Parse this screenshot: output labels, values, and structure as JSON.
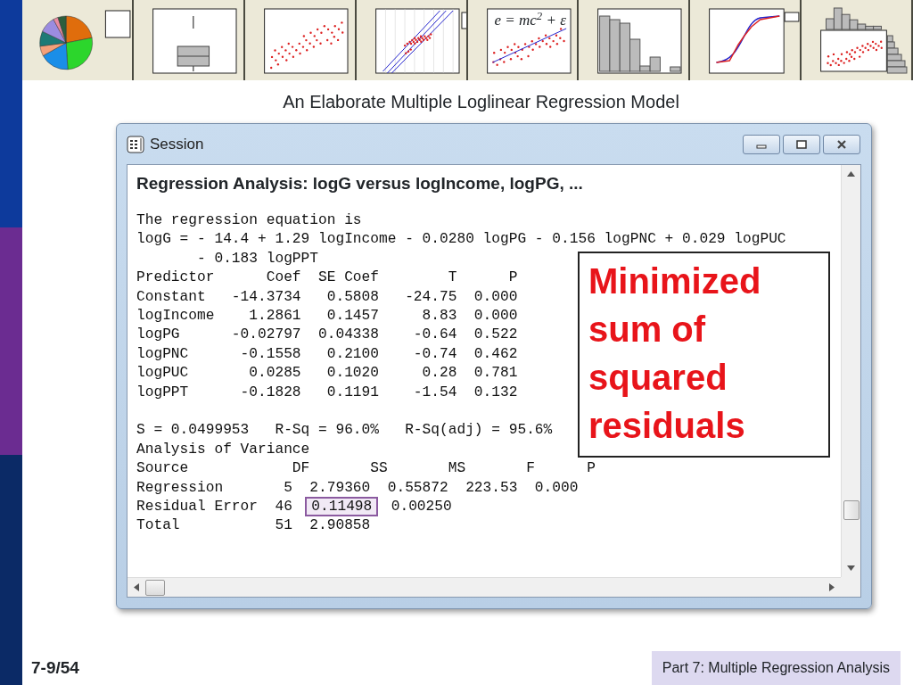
{
  "thumbnails": [
    {
      "kind": "pie"
    },
    {
      "kind": "boxplot"
    },
    {
      "kind": "scatter"
    },
    {
      "kind": "probability"
    },
    {
      "kind": "fitted",
      "formula": "e = mc$^{2}$ + ε"
    },
    {
      "kind": "histogram"
    },
    {
      "kind": "cdf"
    },
    {
      "kind": "marginal"
    }
  ],
  "slide_title": "An Elaborate Multiple Loglinear Regression Model",
  "window": {
    "title": "Session",
    "heading": "Regression Analysis: logG versus logIncome, logPG, ...",
    "lines": [
      {
        "kind": "text",
        "text": "The regression equation is"
      },
      {
        "kind": "text",
        "text": "logG = - 14.4 + 1.29 logIncome - 0.0280 logPG - 0.156 logPNC + 0.029 logPUC"
      },
      {
        "kind": "text",
        "text": "       - 0.183 logPPT"
      },
      {
        "kind": "text",
        "text": "Predictor      Coef  SE Coef        T      P"
      },
      {
        "kind": "text",
        "text": "Constant   -14.3734   0.5808   -24.75  0.000"
      },
      {
        "kind": "text",
        "text": "logIncome    1.2861   0.1457     8.83  0.000"
      },
      {
        "kind": "text",
        "text": "logPG      -0.02797  0.04338    -0.64  0.522"
      },
      {
        "kind": "text",
        "text": "logPNC      -0.1558   0.2100    -0.74  0.462"
      },
      {
        "kind": "text",
        "text": "logPUC       0.0285   0.1020     0.28  0.781"
      },
      {
        "kind": "text",
        "text": "logPPT      -0.1828   0.1191    -1.54  0.132"
      },
      {
        "kind": "gap"
      },
      {
        "kind": "text",
        "text": "S = 0.0499953   R-Sq = 96.0%   R-Sq(adj) = 95.6%"
      },
      {
        "kind": "text",
        "text": "Analysis of Variance"
      },
      {
        "kind": "text",
        "text": "Source            DF       SS       MS       F      P"
      },
      {
        "kind": "text",
        "text": "Regression       5  2.79360  0.55872  223.53  0.000"
      },
      {
        "kind": "boxed",
        "before": "Residual Error  46  ",
        "boxed": "0.11498",
        "after": "  0.00250"
      },
      {
        "kind": "text",
        "text": "Total           51  2.90858"
      }
    ]
  },
  "callout": "Minimized sum of squared residuals",
  "slide_number": "7-9/54",
  "footer": "Part 7: Multiple Regression Analysis"
}
